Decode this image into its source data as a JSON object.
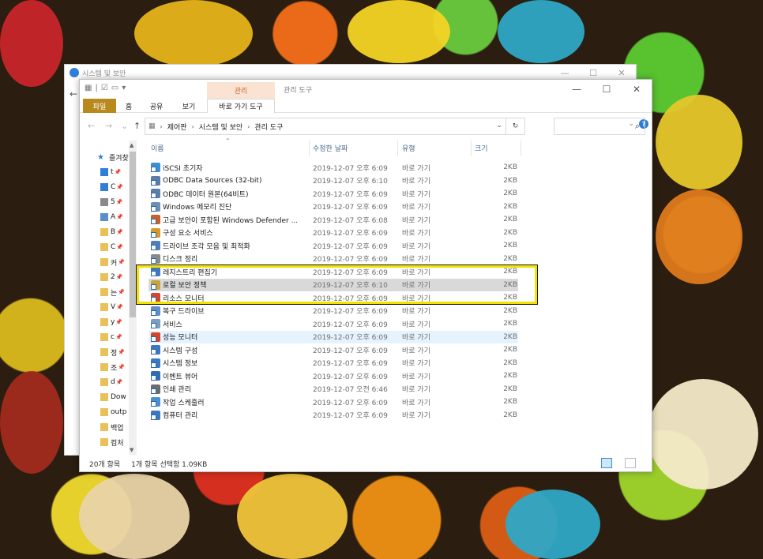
{
  "back_window": {
    "title": "시스템 및 보안"
  },
  "window": {
    "context_tab_label": "관리",
    "context_title": "관리 도구",
    "controls": {
      "minimize": "—",
      "maximize": "☐",
      "close": "✕"
    }
  },
  "ribbon": {
    "tabs": [
      "파일",
      "홈",
      "공유",
      "보기",
      "바로 가기 도구"
    ]
  },
  "address": {
    "crumbs": [
      "제어판",
      "시스템 및 보안",
      "관리 도구"
    ],
    "search_placeholder": ""
  },
  "nav": {
    "items": [
      {
        "label": "즐겨찾",
        "icon": "star-icon"
      },
      {
        "label": "t",
        "icon": "desktop-icon"
      },
      {
        "label": "C",
        "icon": "download-icon"
      },
      {
        "label": "5",
        "icon": "document-icon"
      },
      {
        "label": "A",
        "icon": "pictures-icon"
      },
      {
        "label": "B",
        "icon": "folder-icon"
      },
      {
        "label": "C",
        "icon": "folder-icon"
      },
      {
        "label": "커",
        "icon": "folder-icon"
      },
      {
        "label": "2",
        "icon": "folder-icon"
      },
      {
        "label": "는",
        "icon": "folder-icon"
      },
      {
        "label": "V",
        "icon": "folder-icon"
      },
      {
        "label": "y",
        "icon": "folder-icon"
      },
      {
        "label": "c",
        "icon": "folder-icon"
      },
      {
        "label": "정",
        "icon": "folder-icon"
      },
      {
        "label": "조",
        "icon": "folder-icon"
      },
      {
        "label": "d",
        "icon": "folder-icon"
      },
      {
        "label": "Dow",
        "icon": "folder-icon"
      },
      {
        "label": "outp",
        "icon": "folder-icon"
      },
      {
        "label": "백업",
        "icon": "folder-icon"
      },
      {
        "label": "컴처",
        "icon": "folder-icon"
      }
    ]
  },
  "columns": {
    "name": "이름",
    "date": "수정한 날짜",
    "type": "유형",
    "size": "크기"
  },
  "files": [
    {
      "name": "iSCSI 초기자",
      "date": "2019-12-07 오후 6:09",
      "type": "바로 가기",
      "size": "2KB",
      "color": "#3d8fd6"
    },
    {
      "name": "ODBC Data Sources (32-bit)",
      "date": "2019-12-07 오후 6:10",
      "type": "바로 가기",
      "size": "2KB",
      "color": "#5a7ea8"
    },
    {
      "name": "ODBC 데이터 원본(64비트)",
      "date": "2019-12-07 오후 6:09",
      "type": "바로 가기",
      "size": "2KB",
      "color": "#5a7ea8"
    },
    {
      "name": "Windows 메모리 진단",
      "date": "2019-12-07 오후 6:09",
      "type": "바로 가기",
      "size": "2KB",
      "color": "#6b8fb5"
    },
    {
      "name": "고급 보안이 포함된 Windows Defender ...",
      "date": "2019-12-07 오후 6:08",
      "type": "바로 가기",
      "size": "2KB",
      "color": "#c6612b"
    },
    {
      "name": "구성 요소 서비스",
      "date": "2019-12-07 오후 6:09",
      "type": "바로 가기",
      "size": "2KB",
      "color": "#d69a2a"
    },
    {
      "name": "드라이브 조각 모음 및 최적화",
      "date": "2019-12-07 오후 6:09",
      "type": "바로 가기",
      "size": "2KB",
      "color": "#4f7fb8"
    },
    {
      "name": "디스크 정리",
      "date": "2019-12-07 오후 6:09",
      "type": "바로 가기",
      "size": "2KB",
      "color": "#8a8a8a"
    },
    {
      "name": "레지스트리 편집기",
      "date": "2019-12-07 오후 6:09",
      "type": "바로 가기",
      "size": "2KB",
      "color": "#3f77c2"
    },
    {
      "name": "로컬 보안 정책",
      "date": "2019-12-07 오후 6:10",
      "type": "바로 가기",
      "size": "2KB",
      "color": "#c9a43b"
    },
    {
      "name": "리소스 모니터",
      "date": "2019-12-07 오후 6:09",
      "type": "바로 가기",
      "size": "2KB",
      "color": "#d2452e"
    },
    {
      "name": "복구 드라이브",
      "date": "2019-12-07 오후 6:09",
      "type": "바로 가기",
      "size": "2KB",
      "color": "#5c8fc9"
    },
    {
      "name": "서비스",
      "date": "2019-12-07 오후 6:09",
      "type": "바로 가기",
      "size": "2KB",
      "color": "#7c9dbf"
    },
    {
      "name": "성능 모니터",
      "date": "2019-12-07 오후 6:09",
      "type": "바로 가기",
      "size": "2KB",
      "color": "#d2452e"
    },
    {
      "name": "시스템 구성",
      "date": "2019-12-07 오후 6:09",
      "type": "바로 가기",
      "size": "2KB",
      "color": "#3c78bf"
    },
    {
      "name": "시스템 정보",
      "date": "2019-12-07 오후 6:09",
      "type": "바로 가기",
      "size": "2KB",
      "color": "#3c78bf"
    },
    {
      "name": "이벤트 뷰어",
      "date": "2019-12-07 오후 6:09",
      "type": "바로 가기",
      "size": "2KB",
      "color": "#2f6db3"
    },
    {
      "name": "인쇄 관리",
      "date": "2019-12-07 오전 6:46",
      "type": "바로 가기",
      "size": "2KB",
      "color": "#6c6c6c"
    },
    {
      "name": "작업 스케줄러",
      "date": "2019-12-07 오후 6:09",
      "type": "바로 가기",
      "size": "2KB",
      "color": "#4a8fd0"
    },
    {
      "name": "컴퓨터 관리",
      "date": "2019-12-07 오후 6:09",
      "type": "바로 가기",
      "size": "2KB",
      "color": "#3c78bf"
    }
  ],
  "selected_index": 9,
  "hover_index": 13,
  "status": {
    "count": "20개 항목",
    "selection": "1개 항목 선택함 1.09KB"
  }
}
